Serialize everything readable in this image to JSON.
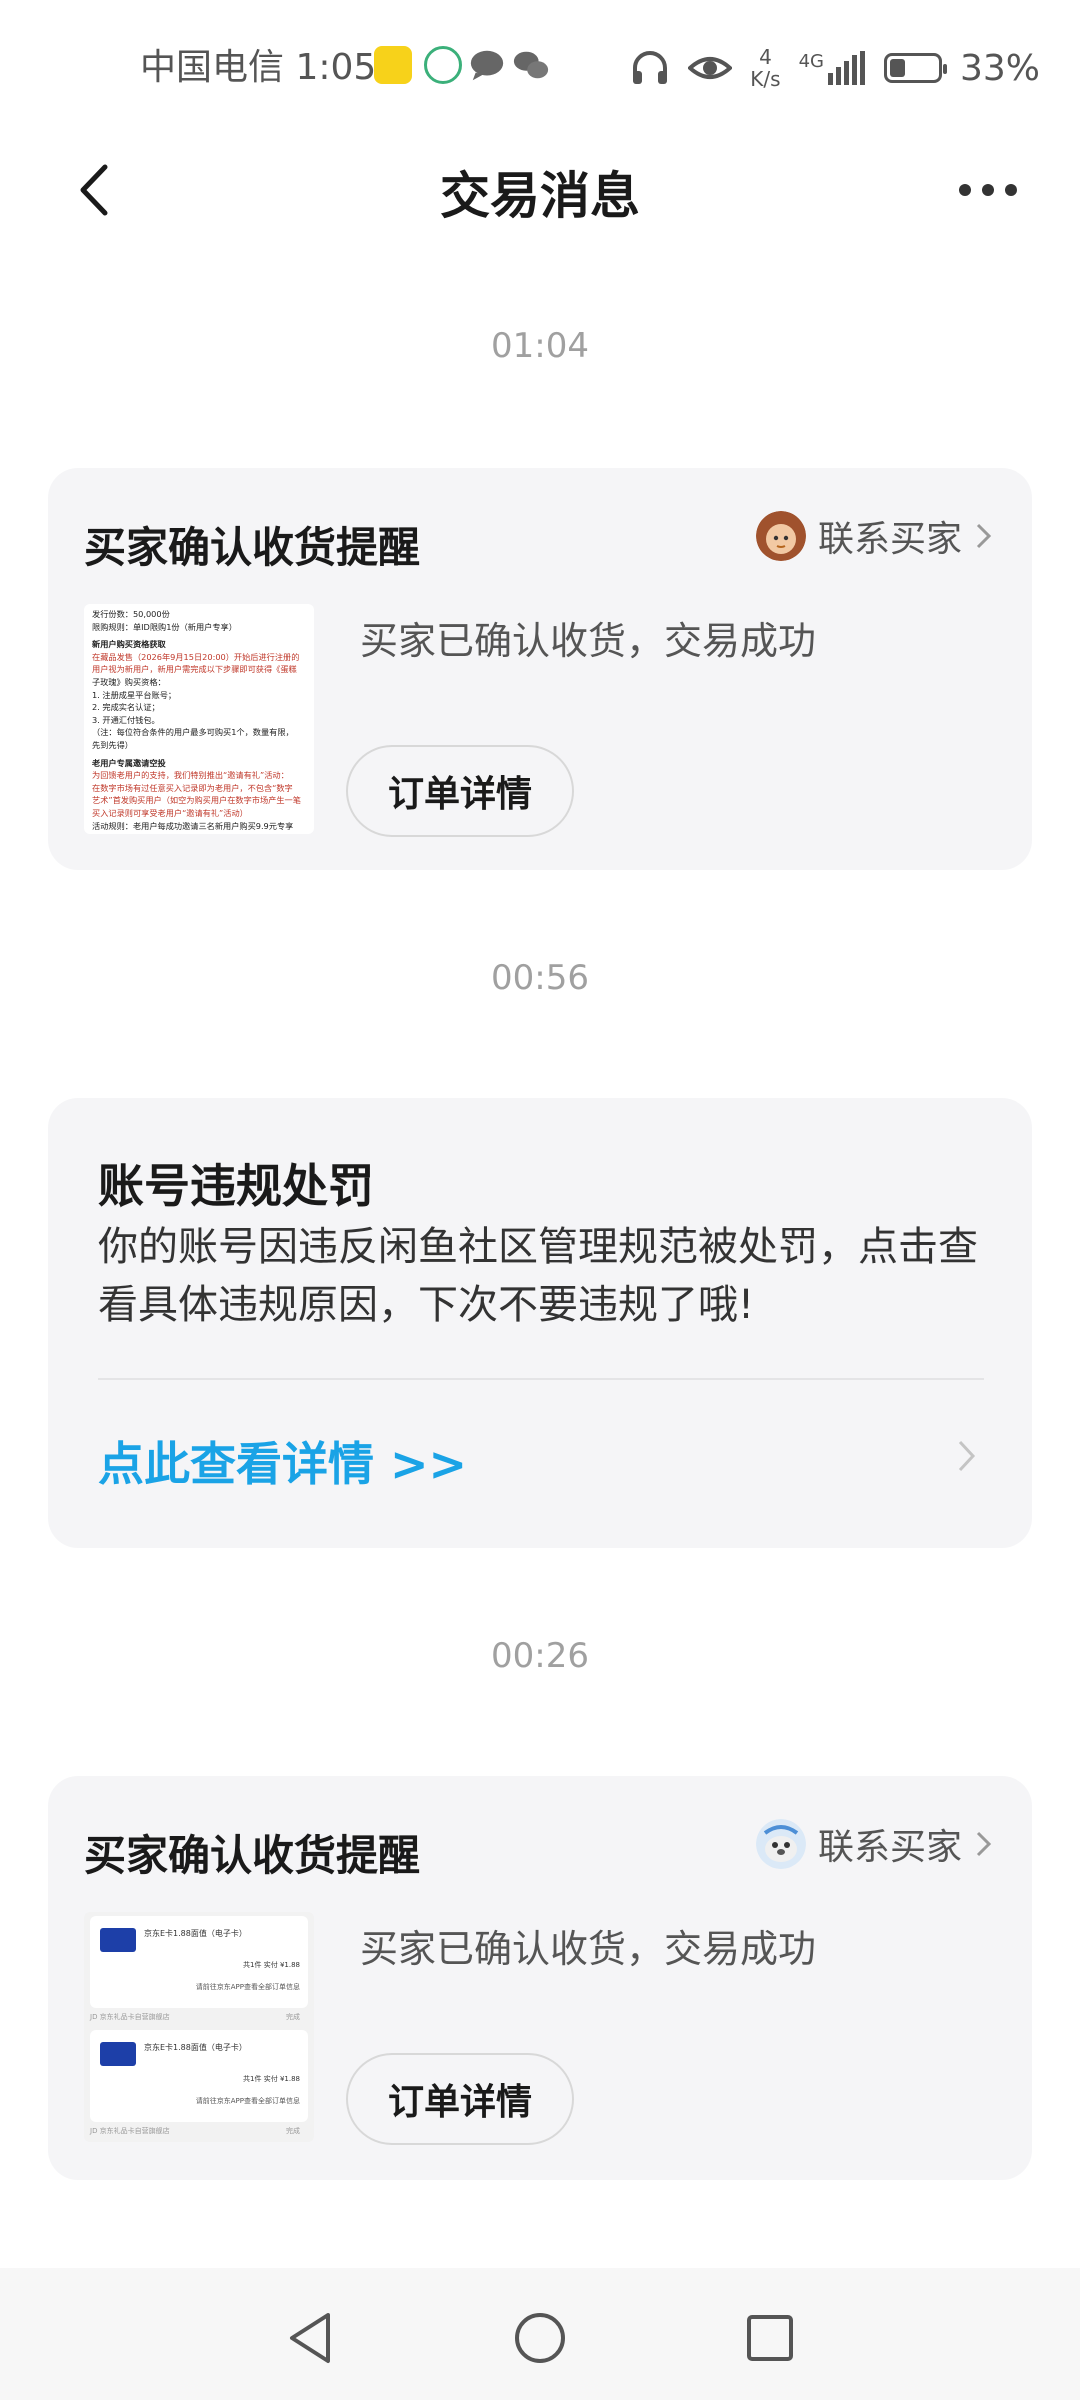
{
  "status_bar": {
    "carrier": "中国电信",
    "time": "1:05",
    "speed_value": "4",
    "speed_unit": "K/s",
    "network": "4G",
    "battery_percent": "33%",
    "battery_level": 0.33
  },
  "header": {
    "title": "交易消息"
  },
  "messages": [
    {
      "timestamp": "01:04",
      "title": "买家确认收货提醒",
      "contact_label": "联系买家",
      "description": "买家已确认收货，交易成功",
      "button_label": "订单详情"
    },
    {
      "timestamp": "00:56",
      "title": "账号违规处罚",
      "body": "你的账号因违反闲鱼社区管理规范被处罚，点击查看具体违规原因，下次不要违规了哦!",
      "link_label": "点此查看详情 >>"
    },
    {
      "timestamp": "00:26",
      "title": "买家确认收货提醒",
      "contact_label": "联系买家",
      "description": "买家已确认收货，交易成功",
      "button_label": "订单详情"
    }
  ],
  "thumb1_lines": [
    "发行份数：50,000份",
    "限购规则：单ID限购1份（新用户专享）",
    "新用户购买资格获取",
    "在藏品发售（2026年9月15日20:00）开始后进行注册的",
    "用户视为新用户，新用户需完成以下步骤即可获得《蛋糕",
    "子玫瑰》购买资格：",
    "1. 注册成星平台账号；",
    "2. 完成实名认证；",
    "3. 开通汇付钱包。",
    "（注：每位符合条件的用户最多可购买1个，数量有限，",
    "先到先得）",
    "老用户专属邀请空投",
    "为回馈老用户的支持，我们特别推出“邀请有礼”活动：",
    "在数字市场有过任意买入记录即为老用户，不包含“数字",
    "艺术”首发购买用户（如空为购买用户在数字市场产生一笔",
    "买入记录则可享受老用户“邀请有礼”活动）",
    "活动规则：老用户每成功邀请三名新用户购买9.9元专享"
  ],
  "thumb2": {
    "product_name": "京东E卡1.88面值（电子卡）",
    "qty": "共1件",
    "paid": "实付 ¥1.88",
    "note": "请前往京东APP查看全部订单信息",
    "store": "JD 京东礼品卡自营旗舰店",
    "status": "完成"
  },
  "colors": {
    "accent_link": "#1aa3e6",
    "card_bg": "#f5f5f7",
    "timestamp": "#a0a0a0"
  },
  "icons": {
    "back": "chevron-left-icon",
    "more": "more-dots-icon",
    "nav_back": "triangle-back-icon",
    "nav_home": "circle-home-icon",
    "nav_recent": "square-recent-icon"
  }
}
